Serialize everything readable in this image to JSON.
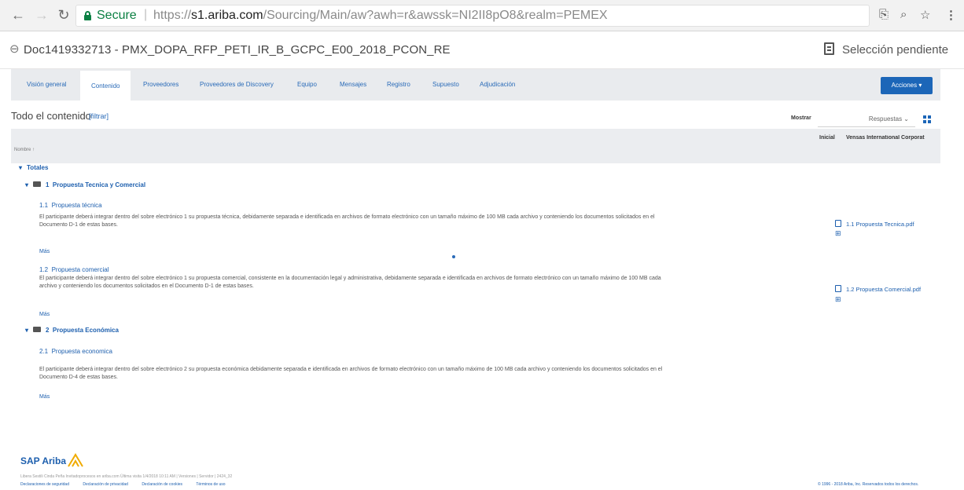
{
  "browser": {
    "secure_label": "Secure",
    "url_scheme": "https://",
    "url_domain": "s1.ariba.com",
    "url_rest": "/Sourcing/Main/aw?awh=r&awssk=NI2II8pO8&realm=PEMEX"
  },
  "header": {
    "doc_title": "Doc1419332713 - PMX_DOPA_RFP_PETI_IR_B_GCPC_E00_2018_PCON_RE",
    "status": "Selección pendiente"
  },
  "tabs": [
    {
      "label": "Visión general"
    },
    {
      "label": "Contenido"
    },
    {
      "label": "Proveedores"
    },
    {
      "label": "Proveedores de Discovery"
    },
    {
      "label": "Equipo"
    },
    {
      "label": "Mensajes"
    },
    {
      "label": "Registro"
    },
    {
      "label": "Supuesto"
    },
    {
      "label": "Adjudicación"
    }
  ],
  "actions_label": "Acciones ▾",
  "content": {
    "title": "Todo el contenido",
    "filter": "[filtrar]",
    "show_label": "Mostrar",
    "show_value": "Respuestas ⌄"
  },
  "table": {
    "col_name": "Nombre ↑",
    "col_initial": "Inicial",
    "col_vendor": "Vensas International Corporat"
  },
  "rows": {
    "totals": "Totales",
    "section1": {
      "num": "1",
      "title": "Propuesta Tecnica y Comercial"
    },
    "item11": {
      "num": "1.1",
      "title": "Propuesta técnica",
      "desc1": "El participante deberá integrar dentro del sobre electrónico 1 su propuesta técnica, debidamente separada e identificada en archivos de formato electrónico con un tamaño máximo de 100 MB cada archivo y conteniendo los documentos solicitados en el",
      "desc2": "Documento D-1 de estas bases.",
      "more": "Más",
      "attachment": "1.1 Propuesta Tecnica.pdf"
    },
    "item12": {
      "num": "1.2",
      "title": "Propuesta comercial",
      "desc1": "El participante deberá integrar dentro del sobre electrónico 1 su propuesta comercial, consistente en la documentación legal y administrativa, debidamente separada e identificada en archivos de formato electrónico con un tamaño máximo de 100 MB cada",
      "desc2": "archivo y conteniendo los documentos solicitados en el Documento D-1 de estas bases.",
      "more": "Más",
      "attachment": "1.2 Propuesta Comercial.pdf"
    },
    "section2": {
      "num": "2",
      "title": "Propuesta Económica"
    },
    "item21": {
      "num": "2.1",
      "title": "Propuesta economica",
      "desc1": "El participante deberá integrar dentro del sobre electrónico 2 su propuesta económica debidamente separada e identificada en archivos de formato electrónico con un tamaño máximo de 100 MB cada archivo y conteniendo los documentos solicitados en el",
      "desc2": "Documento D-4 de estas bases.",
      "more": "Más"
    }
  },
  "footer": {
    "brand": "SAP Ariba",
    "small": "Libera Sestili Cinda Peña Invitadoprocesos en ariba.com Última visita 1/4/2018 10:11 AM | Versiones | Servidor | 2424_32",
    "links": [
      "Declaraciones de seguridad",
      "Declaración de privacidad",
      "Declaración de cookies",
      "Términos de uso"
    ],
    "copyright": "© 1996 - 2018 Ariba, Inc. Reservados todos los derechos."
  }
}
